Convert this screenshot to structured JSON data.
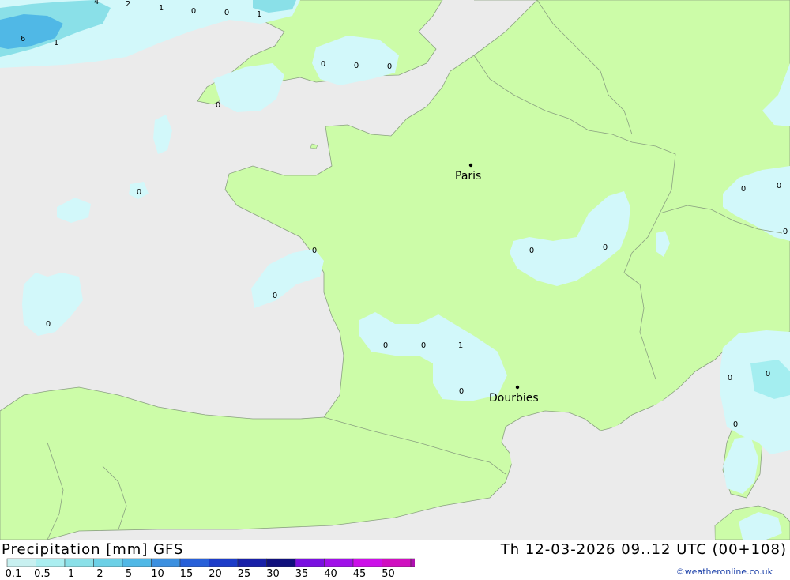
{
  "map": {
    "cities": [
      {
        "name": "Paris"
      },
      {
        "name": "Dourbies"
      }
    ],
    "value_labels": [
      "4",
      "2",
      "1",
      "0",
      "0",
      "1",
      "6",
      "1",
      "0",
      "0",
      "0",
      "0",
      "0",
      "0",
      "0",
      "0",
      "0",
      "0",
      "0",
      "0",
      "0",
      "0",
      "0",
      "1",
      "0",
      "0",
      "0",
      "0"
    ]
  },
  "footer": {
    "title": "Precipitation [mm] GFS",
    "valid_time": "Th 12-03-2026 09..12 UTC (00+108)",
    "credit": "©weatheronline.co.uk",
    "legend": {
      "ticks": [
        "0.1",
        "0.5",
        "1",
        "2",
        "5",
        "10",
        "15",
        "20",
        "25",
        "30",
        "35",
        "40",
        "45",
        "50"
      ],
      "colors": [
        "#c8f0f0",
        "#aaeef0",
        "#8ae0e8",
        "#6cd0e6",
        "#50b8e6",
        "#3c90e0",
        "#2860d8",
        "#1c3cc8",
        "#1820a8",
        "#10107c",
        "#7a10e0",
        "#a010e8",
        "#cc10e8",
        "#d010c0",
        "#b010b0"
      ]
    }
  }
}
